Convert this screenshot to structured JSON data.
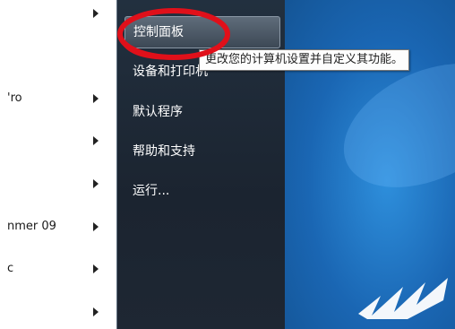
{
  "left_pane": {
    "items": [
      {
        "label": ""
      },
      {
        "label": "'ro"
      },
      {
        "label": ""
      },
      {
        "label": ""
      },
      {
        "label": "nmer 09"
      },
      {
        "label": "c"
      },
      {
        "label": ""
      }
    ]
  },
  "right_menu": {
    "items": [
      {
        "label": "控制面板"
      },
      {
        "label": "设备和打印机"
      },
      {
        "label": "默认程序"
      },
      {
        "label": "帮助和支持"
      },
      {
        "label": "运行..."
      }
    ]
  },
  "tooltip": {
    "text": "更改您的计算机设置并自定义其功能。"
  },
  "colors": {
    "menu_bg": "#1b2430",
    "desktop_bg": "#1c6fb8",
    "annotation": "#e0101a"
  }
}
